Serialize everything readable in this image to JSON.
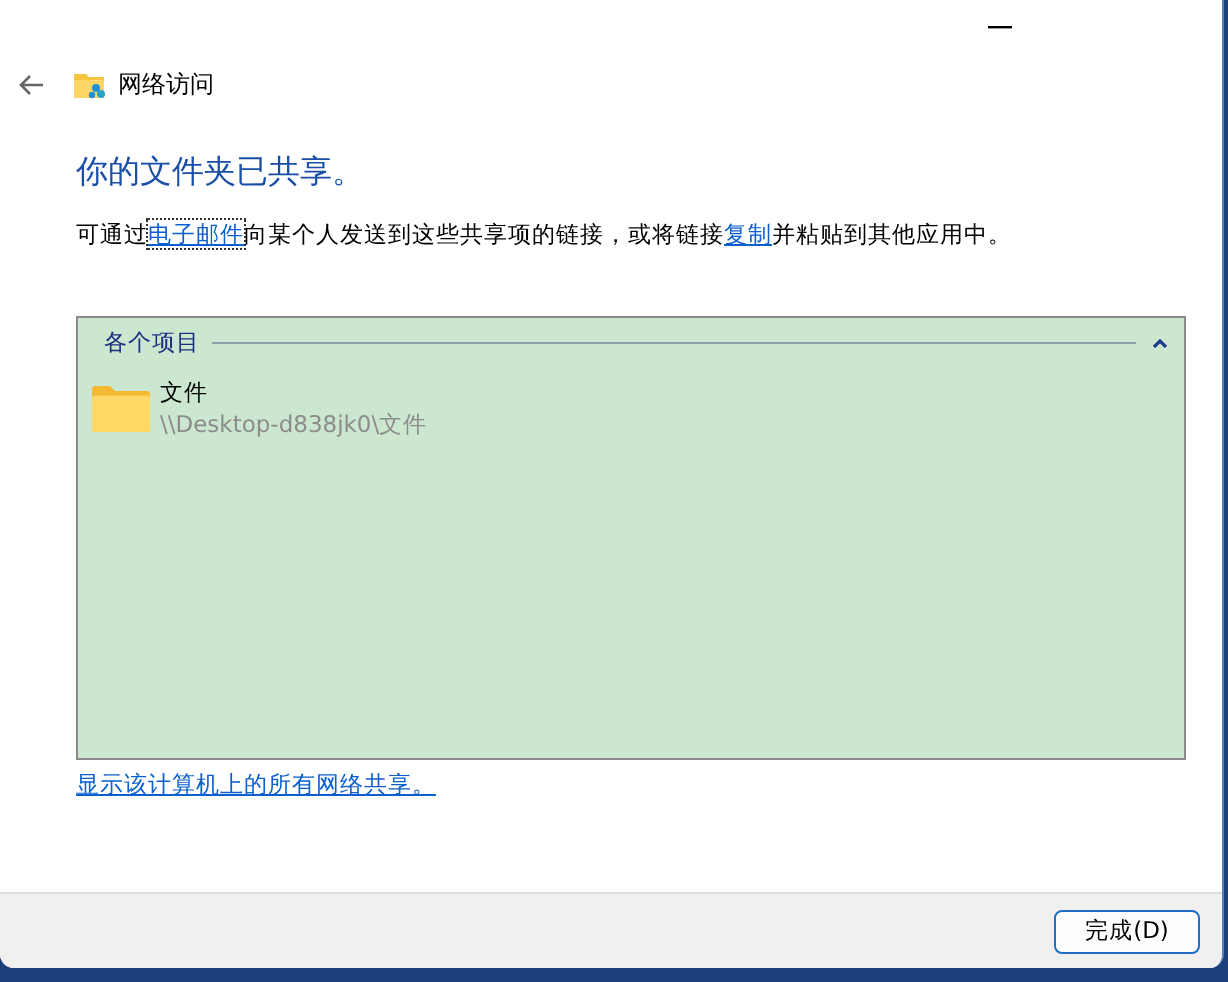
{
  "window": {
    "title": "网络访问"
  },
  "heading": "你的文件夹已共享。",
  "description": [
    {
      "kind": "text",
      "text": "可通过"
    },
    {
      "kind": "link",
      "text": "电子邮件",
      "focused": true
    },
    {
      "kind": "text",
      "text": "向某个人发送到这些共享项的链接，或将链接"
    },
    {
      "kind": "link",
      "text": "复制",
      "focused": false
    },
    {
      "kind": "text",
      "text": "并粘贴到其他应用中。"
    }
  ],
  "group": {
    "label": "各个项目",
    "expanded": true,
    "items": [
      {
        "name": "文件",
        "path": "\\\\Desktop-d838jk0\\文件"
      }
    ]
  },
  "show_all_link": "显示该计算机上的所有网络共享。",
  "buttons": [
    {
      "label": "完成(D)"
    }
  ]
}
